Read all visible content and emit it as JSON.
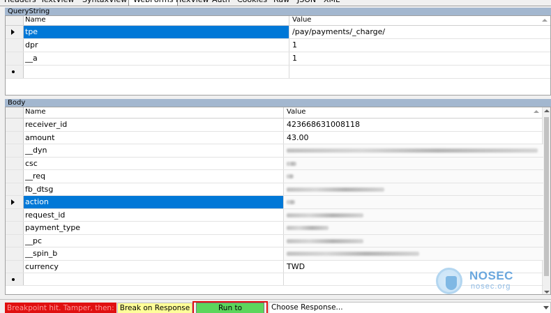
{
  "tabs": [
    {
      "label": "Headers",
      "selected": false
    },
    {
      "label": "TextView",
      "selected": false
    },
    {
      "label": "SyntaxView",
      "selected": false
    },
    {
      "label": "WebForms",
      "selected": true
    },
    {
      "label": "HexView",
      "selected": false
    },
    {
      "label": "Auth",
      "selected": false
    },
    {
      "label": "Cookies",
      "selected": false
    },
    {
      "label": "Raw",
      "selected": false
    },
    {
      "label": "JSON",
      "selected": false
    },
    {
      "label": "XML",
      "selected": false
    }
  ],
  "querystring": {
    "title": "QueryString",
    "col_name": "Name",
    "col_value": "Value",
    "rows": [
      {
        "name": "tpe",
        "value": "/pay/payments/_charge/",
        "selected": true
      },
      {
        "name": "dpr",
        "value": "1",
        "selected": false
      },
      {
        "name": "__a",
        "value": "1",
        "selected": false
      }
    ]
  },
  "body": {
    "title": "Body",
    "col_name": "Name",
    "col_value": "Value",
    "rows": [
      {
        "name": "receiver_id",
        "value": "423668631008118",
        "blurred": false,
        "selected": false
      },
      {
        "name": "amount",
        "value": "43.00",
        "blurred": false,
        "selected": false
      },
      {
        "name": "__dyn",
        "value": "",
        "blurred": true,
        "selected": false
      },
      {
        "name": "csc",
        "value": "",
        "blurred": true,
        "selected": false
      },
      {
        "name": "__req",
        "value": "",
        "blurred": true,
        "selected": false
      },
      {
        "name": "fb_dtsg",
        "value": "",
        "blurred": true,
        "selected": false
      },
      {
        "name": "action",
        "value": "",
        "blurred": true,
        "selected": true
      },
      {
        "name": "request_id",
        "value": "",
        "blurred": true,
        "selected": false
      },
      {
        "name": "payment_type",
        "value": "",
        "blurred": true,
        "selected": false
      },
      {
        "name": "__pc",
        "value": "",
        "blurred": true,
        "selected": false
      },
      {
        "name": "__spin_b",
        "value": "",
        "blurred": true,
        "selected": false
      },
      {
        "name": "currency",
        "value": "TWD",
        "blurred": false,
        "selected": false
      }
    ]
  },
  "footer": {
    "breakpoint_text": "Breakpoint hit. Tamper, then:",
    "break_on_response": "Break on Response",
    "run_to_completion": "Run to Completion",
    "choose_response": "Choose Response..."
  },
  "watermark": {
    "name": "NOSEC",
    "domain": "nosec.org"
  }
}
